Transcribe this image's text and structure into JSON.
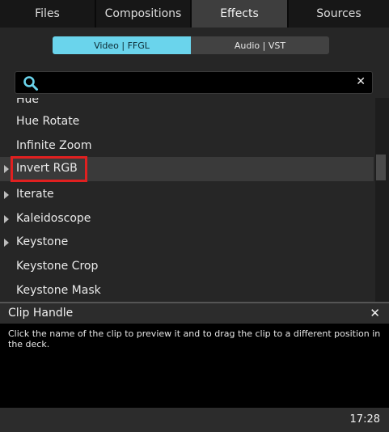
{
  "tabs": [
    {
      "label": "Files",
      "active": false
    },
    {
      "label": "Compositions",
      "active": false
    },
    {
      "label": "Effects",
      "active": true
    },
    {
      "label": "Sources",
      "active": false
    }
  ],
  "filter": {
    "options": [
      "Video | FFGL",
      "Audio | VST"
    ],
    "selected": "Video | FFGL"
  },
  "search": {
    "value": "",
    "icon": "search-icon",
    "clear_icon": "close-icon",
    "clear_label": "✕"
  },
  "effects": {
    "partial_top": "Hue",
    "items": [
      {
        "label": "Hue Rotate",
        "has_children": false,
        "selected": false
      },
      {
        "label": "Infinite Zoom",
        "has_children": false,
        "selected": false
      },
      {
        "label": "Invert RGB",
        "has_children": true,
        "selected": true
      },
      {
        "label": "Iterate",
        "has_children": true,
        "selected": false
      },
      {
        "label": "Kaleidoscope",
        "has_children": true,
        "selected": false
      },
      {
        "label": "Keystone",
        "has_children": true,
        "selected": false
      },
      {
        "label": "Keystone Crop",
        "has_children": false,
        "selected": false
      },
      {
        "label": "Keystone Mask",
        "has_children": false,
        "selected": false
      }
    ]
  },
  "help": {
    "title": "Clip Handle",
    "close_label": "✕",
    "text": "Click the name of the clip to preview it and to drag the clip to a different position in the deck."
  },
  "status": {
    "time": "17:28"
  },
  "colors": {
    "accent": "#6ad4ec",
    "highlight": "#e02020",
    "panel": "#262626"
  }
}
